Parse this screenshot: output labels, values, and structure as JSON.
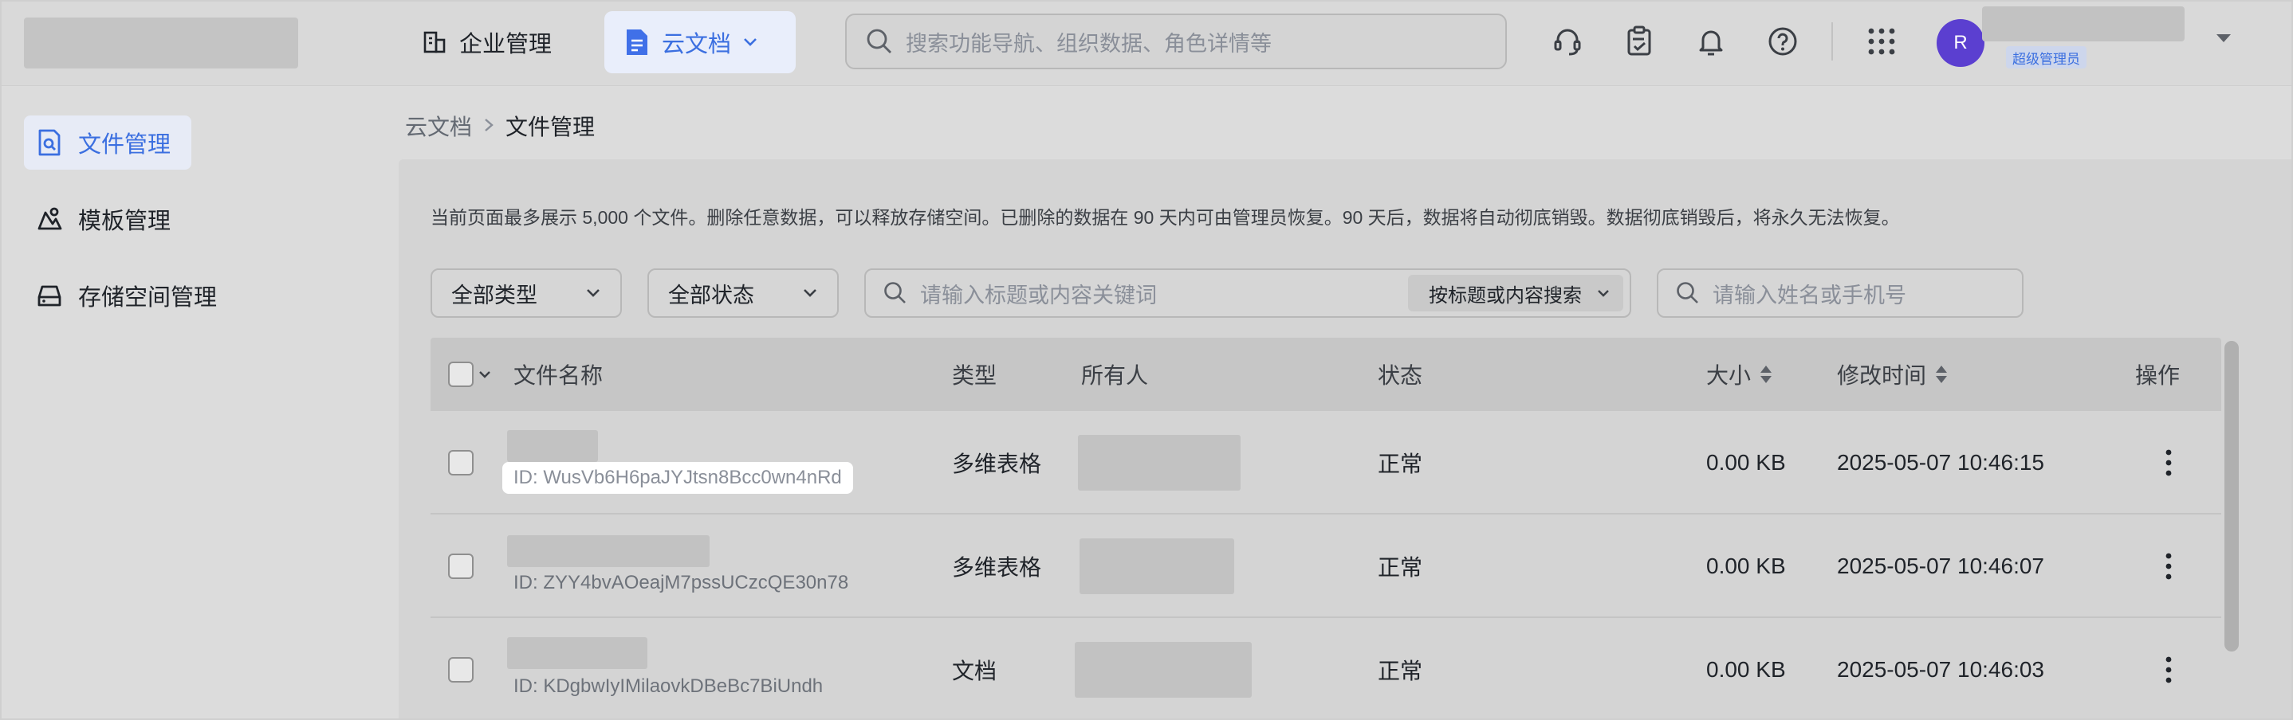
{
  "header": {
    "nav_enterprise": "企业管理",
    "nav_cloud_docs": "云文档",
    "search_placeholder": "搜索功能导航、组织数据、角色详情等",
    "user_initial": "R",
    "user_role": "超级管理员",
    "icons": [
      "headset-icon",
      "clipboard-check-icon",
      "bell-icon",
      "help-icon",
      "app-grid-icon"
    ]
  },
  "sidebar": {
    "items": [
      {
        "label": "文件管理",
        "icon": "file-search-icon",
        "active": true
      },
      {
        "label": "模板管理",
        "icon": "template-icon",
        "active": false
      },
      {
        "label": "存储空间管理",
        "icon": "storage-icon",
        "active": false
      }
    ]
  },
  "breadcrumb": {
    "parent": "云文档",
    "current": "文件管理"
  },
  "notice": "当前页面最多展示 5,000 个文件。删除任意数据，可以释放存储空间。已删除的数据在 90 天内可由管理员恢复。90 天后，数据将自动彻底销毁。数据彻底销毁后，将永久无法恢复。",
  "filters": {
    "type_select": "全部类型",
    "status_select": "全部状态",
    "keyword_placeholder": "请输入标题或内容关键词",
    "keyword_mode": "按标题或内容搜索",
    "user_placeholder": "请输入姓名或手机号"
  },
  "table": {
    "headers": {
      "name": "文件名称",
      "type": "类型",
      "owner": "所有人",
      "status": "状态",
      "size": "大小",
      "modified": "修改时间",
      "actions": "操作"
    },
    "rows": [
      {
        "id": "ID: WusVb6H6paJYJtsn8Bcc0wn4nRd",
        "type": "多维表格",
        "status": "正常",
        "size": "0.00 KB",
        "modified": "2025-05-07 10:46:15"
      },
      {
        "id": "ID: ZYY4bvAOeajM7pssUCzcQE30n78",
        "type": "多维表格",
        "status": "正常",
        "size": "0.00 KB",
        "modified": "2025-05-07 10:46:07"
      },
      {
        "id": "ID: KDgbwIyIMilaovkDBeBc7BiUndh",
        "type": "文档",
        "status": "正常",
        "size": "0.00 KB",
        "modified": "2025-05-07 10:46:03"
      }
    ]
  },
  "colors": {
    "accent": "#3b6fe0",
    "avatar": "#5b3fd0"
  }
}
